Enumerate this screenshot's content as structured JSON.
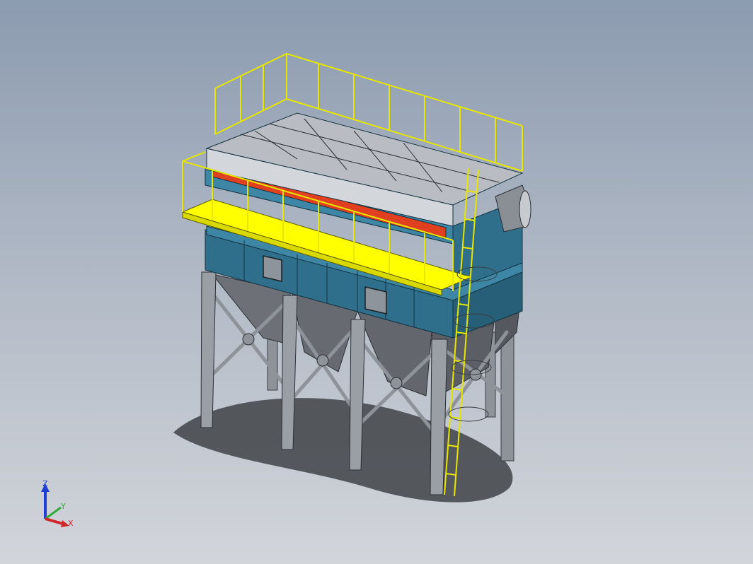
{
  "viewport": {
    "background_top": "#8c9bb0",
    "background_bottom": "#d2d5da"
  },
  "model": {
    "body_color": "#2f6f8c",
    "walkway_color": "#ffff00",
    "railing_color": "#e6e600",
    "heater_color": "#e0401f",
    "steel_color": "#8e9299",
    "hopper_color": "#6d7177",
    "roof_color": "#b9bcc2"
  },
  "triad": {
    "z_label": "Z",
    "y_label": "Y",
    "x_label": "X",
    "z_color": "#1f3fd1",
    "y_color": "#2eaa3a",
    "x_color": "#d0262b"
  }
}
